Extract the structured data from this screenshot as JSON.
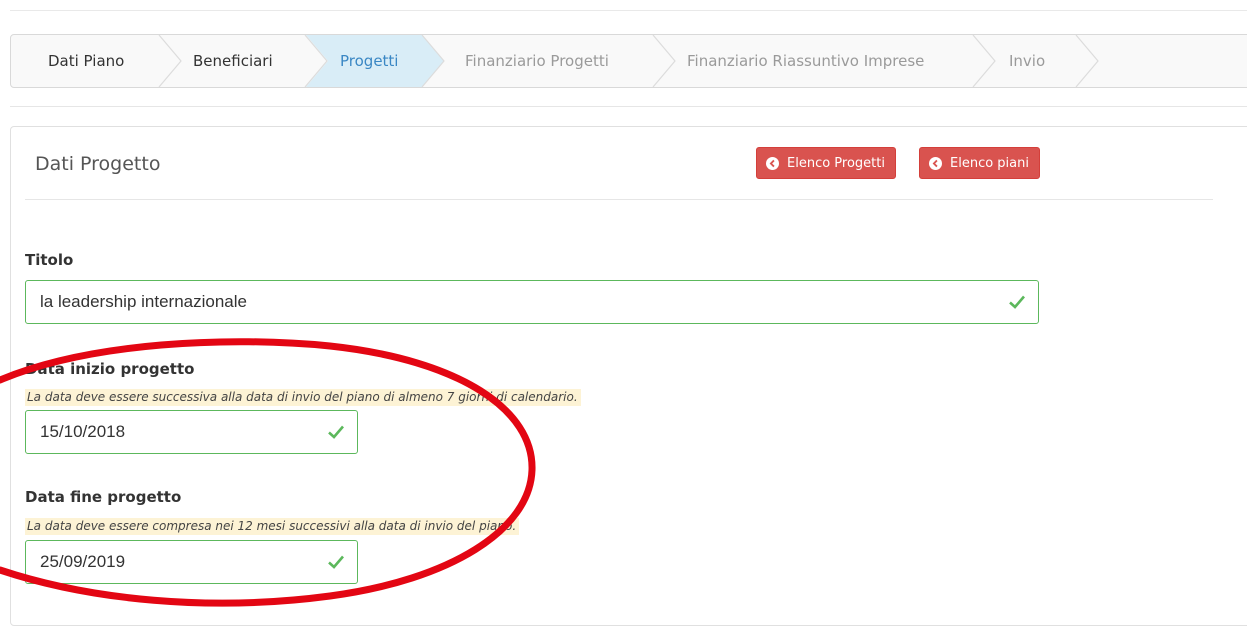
{
  "wizard": {
    "steps": [
      {
        "label": "Dati Piano",
        "state": "done"
      },
      {
        "label": "Beneficiari",
        "state": "done"
      },
      {
        "label": "Progetti",
        "state": "active"
      },
      {
        "label": "Finanziario Progetti",
        "state": "disabled"
      },
      {
        "label": "Finanziario Riassuntivo Imprese",
        "state": "disabled"
      },
      {
        "label": "Invio",
        "state": "disabled"
      }
    ]
  },
  "panel": {
    "title": "Dati Progetto",
    "buttons": {
      "elenco_progetti": "Elenco Progetti",
      "elenco_piani": "Elenco piani"
    }
  },
  "form": {
    "titolo": {
      "label": "Titolo",
      "value": "la leadership internazionale"
    },
    "data_inizio": {
      "label": "Data inizio progetto",
      "hint": "La data deve essere successiva alla data di invio del piano di almeno 7 giorni di calendario.",
      "value": "15/10/2018"
    },
    "data_fine": {
      "label": "Data fine progetto",
      "hint": "La data deve essere compresa nei 12 mesi successivi alla data di invio del piano.",
      "value": "25/09/2019"
    }
  },
  "colors": {
    "active_step_bg": "#d9edf7",
    "active_step_text": "#3a87c4",
    "danger": "#d9534f",
    "success": "#5cb85c",
    "hint_bg": "#fdf3d5",
    "annotation_red": "#e30613"
  },
  "icons": {
    "nav_buttons": "arrow-circle-left-icon",
    "field_valid": "check-icon"
  }
}
